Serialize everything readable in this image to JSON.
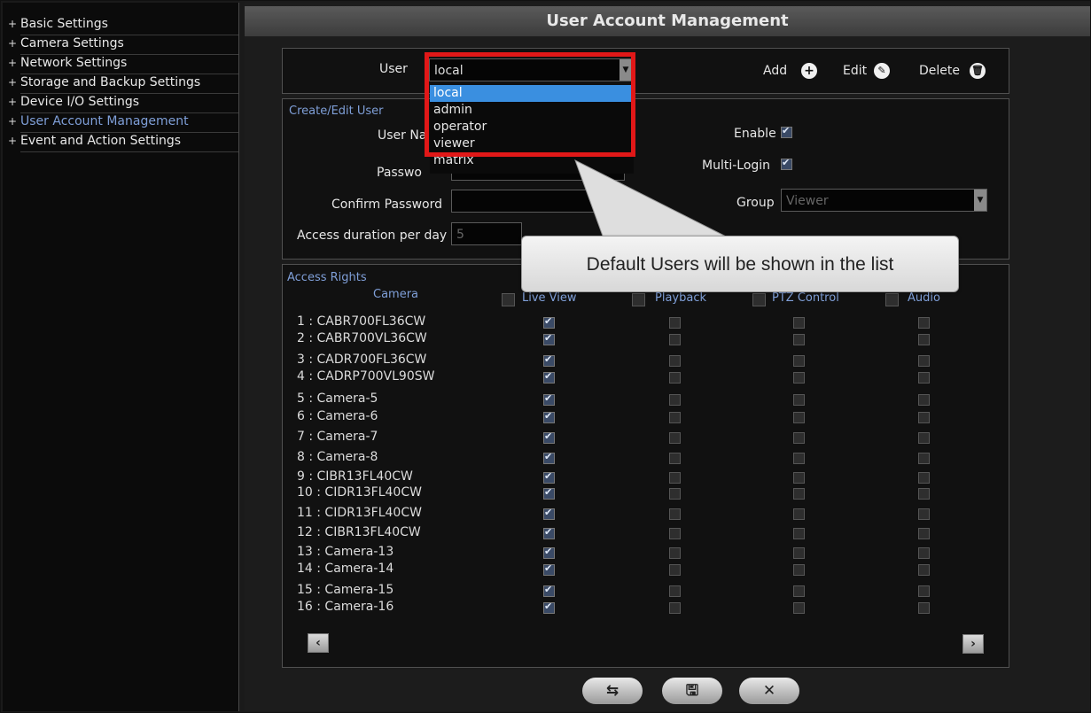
{
  "sidebar": {
    "items": [
      {
        "label": "Basic Settings"
      },
      {
        "label": "Camera Settings"
      },
      {
        "label": "Network Settings"
      },
      {
        "label": "Storage and Backup Settings"
      },
      {
        "label": "Device I/O Settings"
      },
      {
        "label": "User Account Management",
        "active": true
      },
      {
        "label": "Event and Action Settings"
      }
    ]
  },
  "header": {
    "title": "User Account Management"
  },
  "user_bar": {
    "user_label": "User",
    "user_value": "local",
    "add_label": "Add",
    "edit_label": "Edit",
    "delete_label": "Delete"
  },
  "user_dropdown": {
    "options": [
      "local",
      "admin",
      "operator",
      "viewer",
      "matrix"
    ],
    "selected": "local"
  },
  "edit_user": {
    "section_title": "Create/Edit User",
    "username_label": "User Na",
    "password_label": "Passwo",
    "confirm_password_label": "Confirm Password",
    "access_duration_label": "Access duration per day",
    "access_duration_value": "5",
    "enable_label": "Enable",
    "enable_checked": true,
    "multilogin_label": "Multi-Login",
    "multilogin_checked": true,
    "group_label": "Group",
    "group_value": "Viewer"
  },
  "access_rights": {
    "section_title": "Access Rights",
    "columns": [
      "Camera",
      "Live View",
      "Playback",
      "PTZ Control",
      "Audio"
    ],
    "cameras": [
      {
        "name": "1 : CABR700FL36CW",
        "live": true
      },
      {
        "name": "2 : CABR700VL36CW",
        "live": true
      },
      {
        "name": "3 : CADR700FL36CW",
        "live": true
      },
      {
        "name": "4 : CADRP700VL90SW",
        "live": true
      },
      {
        "name": "5 : Camera-5",
        "live": true
      },
      {
        "name": "6 : Camera-6",
        "live": true
      },
      {
        "name": "7 : Camera-7",
        "live": true
      },
      {
        "name": "8 : Camera-8",
        "live": true
      },
      {
        "name": "9 : CIBR13FL40CW",
        "live": true
      },
      {
        "name": "10 : CIDR13FL40CW",
        "live": true
      },
      {
        "name": "11 : CIDR13FL40CW",
        "live": true
      },
      {
        "name": "12 : CIBR13FL40CW",
        "live": true
      },
      {
        "name": "13 : Camera-13",
        "live": true
      },
      {
        "name": "14 : Camera-14",
        "live": true
      },
      {
        "name": "15 : Camera-15",
        "live": true
      },
      {
        "name": "16 : Camera-16",
        "live": true
      }
    ]
  },
  "callout": {
    "text": "Default Users will be shown in the list"
  },
  "colors": {
    "accent": "#7f9fd8",
    "highlight": "#e11818",
    "selected": "#3a8fe0"
  }
}
